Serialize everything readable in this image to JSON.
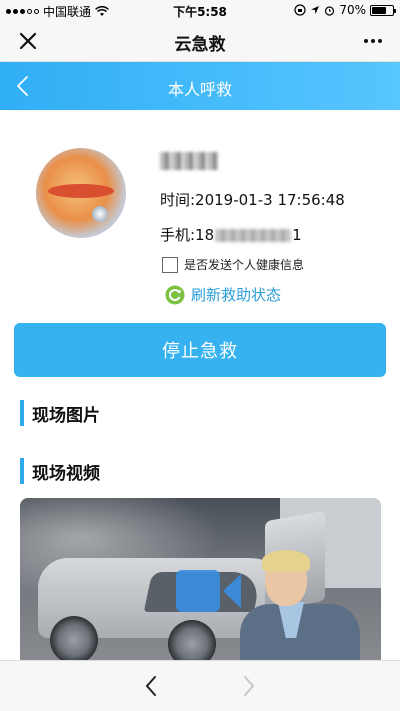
{
  "status_bar": {
    "carrier": "中国联通",
    "time": "下午5:58",
    "battery_text": "70%",
    "battery_level": 0.7
  },
  "title_bar": {
    "title": "云急救",
    "close_icon": "close-icon",
    "more_icon": "more-dots-icon"
  },
  "page_header": {
    "title": "本人呼救",
    "back_icon": "chevron-left-icon",
    "accent_color": "#30aef5"
  },
  "profile": {
    "time_text": "时间:2019-01-3 17:56:48",
    "phone_prefix": "手机:18",
    "phone_suffix": "1"
  },
  "health_checkbox": {
    "label": "是否发送个人健康信息",
    "checked": false
  },
  "refresh": {
    "label": "刷新救助状态",
    "icon": "refresh-icon",
    "color": "#2a9ed8"
  },
  "stop_button": {
    "label": "停止急救",
    "color": "#35b2ef"
  },
  "sections": {
    "photos_title": "现场图片",
    "videos_title": "现场视频"
  },
  "video": {
    "play_icon": "video-camera-icon"
  },
  "bottom_nav": {
    "back_icon": "chevron-left-icon",
    "forward_icon": "chevron-right-icon",
    "forward_enabled": false
  }
}
